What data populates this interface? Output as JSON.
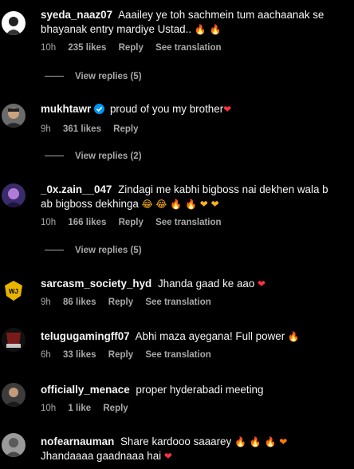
{
  "comments": [
    {
      "username": "syeda_naaz07",
      "text": "Aaailey ye toh sachmein tum aachaanak se bhayanak entry mardiye Ustad..",
      "emojis": "🔥 🔥",
      "time": "10h",
      "likes": "235 likes",
      "reply": "Reply",
      "translate": "See translation",
      "view_replies": "View replies (5)"
    },
    {
      "username": "mukhtawr",
      "verified": true,
      "text": "proud of you my brother",
      "emojis": "❤",
      "time": "9h",
      "likes": "361 likes",
      "reply": "Reply",
      "view_replies": "View replies (2)"
    },
    {
      "username": "_0x.zain__047",
      "text": "Zindagi me kabhi bigboss nai dekhen wala b ab bigboss dekhinga",
      "emojis": "😂 😂 🔥 🔥 ❤ ❤",
      "time": "10h",
      "likes": "166 likes",
      "reply": "Reply",
      "translate": "See translation",
      "view_replies": "View replies (5)"
    },
    {
      "username": "sarcasm_society_hyd",
      "text": "Jhanda gaad ke aao",
      "emojis": "❤",
      "time": "9h",
      "likes": "86 likes",
      "reply": "Reply",
      "translate": "See translation"
    },
    {
      "username": "telugugamingff07",
      "text": "Abhi maza ayegana! Full power",
      "emojis": "🔥",
      "time": "6h",
      "likes": "33 likes",
      "reply": "Reply",
      "translate": "See translation"
    },
    {
      "username": "officially_menace",
      "text": "proper hyderabadi meeting",
      "emojis": "",
      "time": "10h",
      "likes": "1 like",
      "reply": "Reply"
    },
    {
      "username": "nofearnauman",
      "text": "Share kardooo saaarey",
      "emojis": "🔥 🔥 🔥 ❤",
      "text2": "Jhandaaaa gaadnaaa hai",
      "emojis2": "❤"
    }
  ],
  "colors": {
    "background": "#000000",
    "text": "#f5f5f5",
    "muted": "#a8a8a8",
    "heart": "#ff3040",
    "verified": "#0095f6"
  }
}
